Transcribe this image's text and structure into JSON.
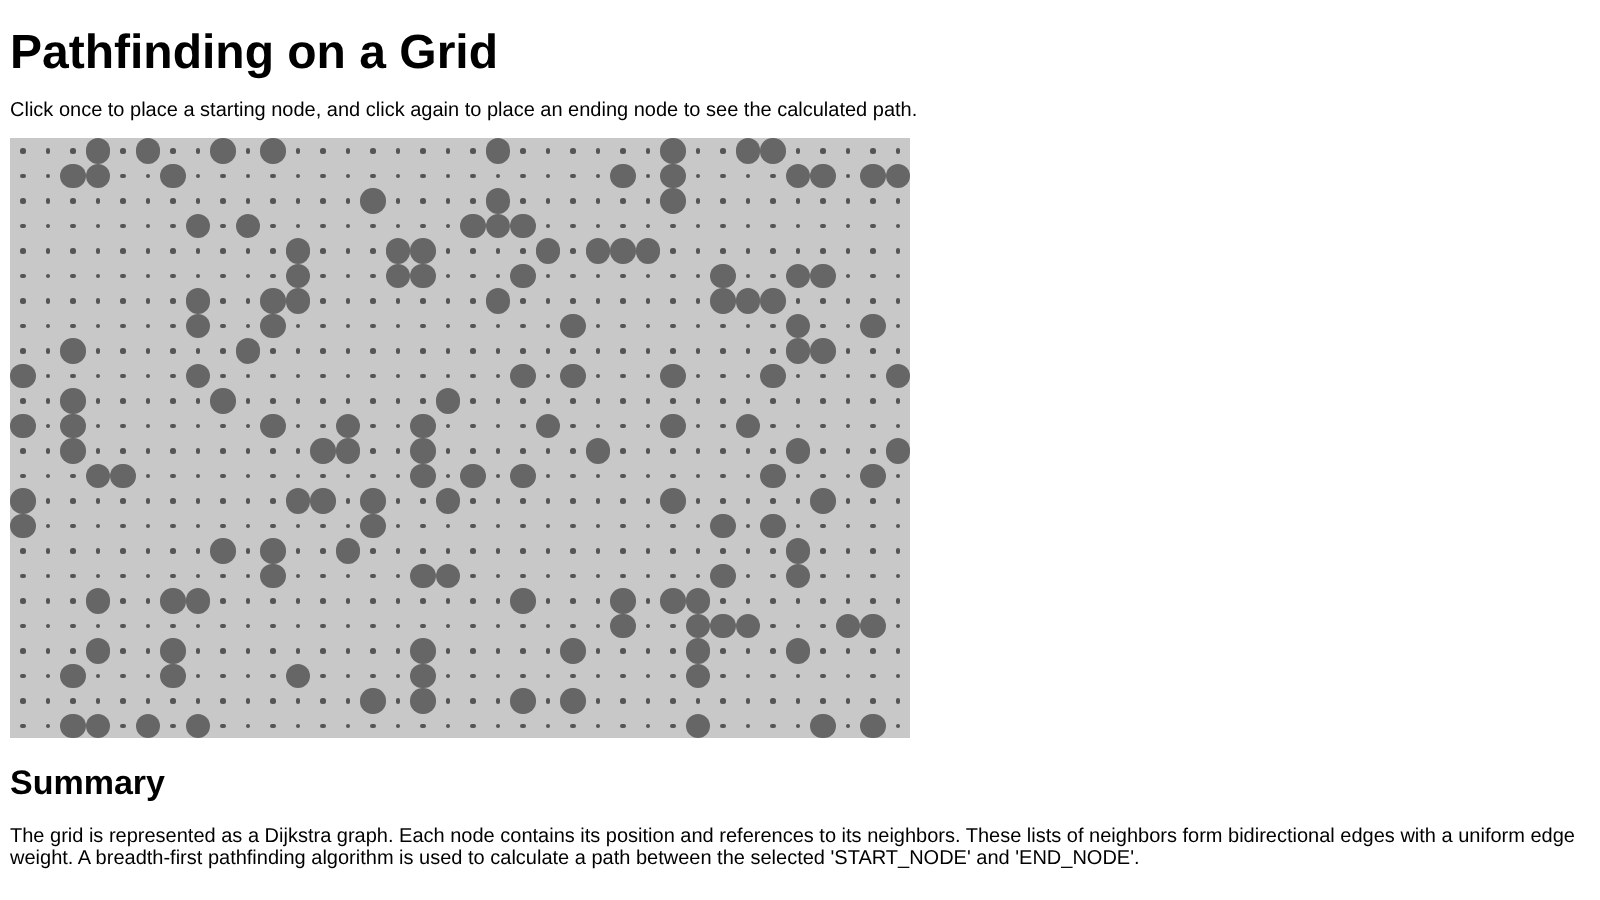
{
  "title": "Pathfinding on a Grid",
  "instructions": "Click once to place a starting node, and click again to place an ending node to see the calculated path.",
  "grid": {
    "rows": [
      [
        false,
        false,
        false,
        true,
        false,
        true,
        false,
        false,
        true,
        false,
        true,
        false,
        false,
        false,
        false,
        false,
        false,
        false,
        false,
        true,
        false,
        false,
        false,
        false,
        false,
        false,
        true,
        false,
        false,
        true,
        true,
        false,
        false,
        false,
        false,
        false
      ],
      [
        false,
        false,
        true,
        true,
        false,
        false,
        true,
        false,
        false,
        false,
        false,
        false,
        false,
        false,
        false,
        false,
        false,
        false,
        false,
        false,
        false,
        false,
        false,
        false,
        true,
        false,
        true,
        false,
        false,
        false,
        false,
        true,
        true,
        false,
        true,
        true
      ],
      [
        false,
        false,
        false,
        false,
        false,
        false,
        false,
        false,
        false,
        false,
        false,
        false,
        false,
        false,
        true,
        false,
        false,
        false,
        false,
        true,
        false,
        false,
        false,
        false,
        false,
        false,
        true,
        false,
        false,
        false,
        false,
        false,
        false,
        false,
        false,
        false
      ],
      [
        false,
        false,
        false,
        false,
        false,
        false,
        false,
        true,
        false,
        true,
        false,
        false,
        false,
        false,
        false,
        false,
        false,
        false,
        true,
        true,
        true,
        false,
        false,
        false,
        false,
        false,
        false,
        false,
        false,
        false,
        false,
        false,
        false,
        false,
        false,
        false
      ],
      [
        false,
        false,
        false,
        false,
        false,
        false,
        false,
        false,
        false,
        false,
        false,
        true,
        false,
        false,
        false,
        true,
        true,
        false,
        false,
        false,
        false,
        true,
        false,
        true,
        true,
        true,
        false,
        false,
        false,
        false,
        false,
        false,
        false,
        false,
        false,
        false
      ],
      [
        false,
        false,
        false,
        false,
        false,
        false,
        false,
        false,
        false,
        false,
        false,
        true,
        false,
        false,
        false,
        true,
        true,
        false,
        false,
        false,
        true,
        false,
        false,
        false,
        false,
        false,
        false,
        false,
        true,
        false,
        false,
        true,
        true,
        false,
        false,
        false
      ],
      [
        false,
        false,
        false,
        false,
        false,
        false,
        false,
        true,
        false,
        false,
        true,
        true,
        false,
        false,
        false,
        false,
        false,
        false,
        false,
        true,
        false,
        false,
        false,
        false,
        false,
        false,
        false,
        false,
        true,
        true,
        true,
        false,
        false,
        false,
        false,
        false
      ],
      [
        false,
        false,
        false,
        false,
        false,
        false,
        false,
        true,
        false,
        false,
        true,
        false,
        false,
        false,
        false,
        false,
        false,
        false,
        false,
        false,
        false,
        false,
        true,
        false,
        false,
        false,
        false,
        false,
        false,
        false,
        false,
        true,
        false,
        false,
        true,
        false
      ],
      [
        false,
        false,
        true,
        false,
        false,
        false,
        false,
        false,
        false,
        true,
        false,
        false,
        false,
        false,
        false,
        false,
        false,
        false,
        false,
        false,
        false,
        false,
        false,
        false,
        false,
        false,
        false,
        false,
        false,
        false,
        false,
        true,
        true,
        false,
        false,
        false
      ],
      [
        true,
        false,
        false,
        false,
        false,
        false,
        false,
        true,
        false,
        false,
        false,
        false,
        false,
        false,
        false,
        false,
        false,
        false,
        false,
        false,
        true,
        false,
        true,
        false,
        false,
        false,
        true,
        false,
        false,
        false,
        true,
        false,
        false,
        false,
        false,
        true
      ],
      [
        false,
        false,
        true,
        false,
        false,
        false,
        false,
        false,
        true,
        false,
        false,
        false,
        false,
        false,
        false,
        false,
        false,
        true,
        false,
        false,
        false,
        false,
        false,
        false,
        false,
        false,
        false,
        false,
        false,
        false,
        false,
        false,
        false,
        false,
        false,
        false
      ],
      [
        true,
        false,
        true,
        false,
        false,
        false,
        false,
        false,
        false,
        false,
        true,
        false,
        false,
        true,
        false,
        false,
        true,
        false,
        false,
        false,
        false,
        true,
        false,
        false,
        false,
        false,
        true,
        false,
        false,
        true,
        false,
        false,
        false,
        false,
        false,
        false
      ],
      [
        false,
        false,
        true,
        false,
        false,
        false,
        false,
        false,
        false,
        false,
        false,
        false,
        true,
        true,
        false,
        false,
        true,
        false,
        false,
        false,
        false,
        false,
        false,
        true,
        false,
        false,
        false,
        false,
        false,
        false,
        false,
        true,
        false,
        false,
        false,
        true
      ],
      [
        false,
        false,
        false,
        true,
        true,
        false,
        false,
        false,
        false,
        false,
        false,
        false,
        false,
        false,
        false,
        false,
        true,
        false,
        true,
        false,
        true,
        false,
        false,
        false,
        false,
        false,
        false,
        false,
        false,
        false,
        true,
        false,
        false,
        false,
        true,
        false
      ],
      [
        true,
        false,
        false,
        false,
        false,
        false,
        false,
        false,
        false,
        false,
        false,
        true,
        true,
        false,
        true,
        false,
        false,
        true,
        false,
        false,
        false,
        false,
        false,
        false,
        false,
        false,
        true,
        false,
        false,
        false,
        false,
        false,
        true,
        false,
        false,
        false
      ],
      [
        true,
        false,
        false,
        false,
        false,
        false,
        false,
        false,
        false,
        false,
        false,
        false,
        false,
        false,
        true,
        false,
        false,
        false,
        false,
        false,
        false,
        false,
        false,
        false,
        false,
        false,
        false,
        false,
        true,
        false,
        true,
        false,
        false,
        false,
        false,
        false
      ],
      [
        false,
        false,
        false,
        false,
        false,
        false,
        false,
        false,
        true,
        false,
        true,
        false,
        false,
        true,
        false,
        false,
        false,
        false,
        false,
        false,
        false,
        false,
        false,
        false,
        false,
        false,
        false,
        false,
        false,
        false,
        false,
        true,
        false,
        false,
        false,
        false
      ],
      [
        false,
        false,
        false,
        false,
        false,
        false,
        false,
        false,
        false,
        false,
        true,
        false,
        false,
        false,
        false,
        false,
        true,
        true,
        false,
        false,
        false,
        false,
        false,
        false,
        false,
        false,
        false,
        false,
        true,
        false,
        false,
        true,
        false,
        false,
        false,
        false
      ],
      [
        false,
        false,
        false,
        true,
        false,
        false,
        true,
        true,
        false,
        false,
        false,
        false,
        false,
        false,
        false,
        false,
        false,
        false,
        false,
        false,
        true,
        false,
        false,
        false,
        true,
        false,
        true,
        true,
        false,
        false,
        false,
        false,
        false,
        false,
        false,
        false
      ],
      [
        false,
        false,
        false,
        false,
        false,
        false,
        false,
        false,
        false,
        false,
        false,
        false,
        false,
        false,
        false,
        false,
        false,
        false,
        false,
        false,
        false,
        false,
        false,
        false,
        true,
        false,
        false,
        true,
        true,
        true,
        false,
        false,
        false,
        true,
        true,
        false
      ],
      [
        false,
        false,
        false,
        true,
        false,
        false,
        true,
        false,
        false,
        false,
        false,
        false,
        false,
        false,
        false,
        false,
        true,
        false,
        false,
        false,
        false,
        false,
        true,
        false,
        false,
        false,
        false,
        true,
        false,
        false,
        false,
        true,
        false,
        false,
        false,
        false
      ],
      [
        false,
        false,
        true,
        false,
        false,
        false,
        true,
        false,
        false,
        false,
        false,
        true,
        false,
        false,
        false,
        false,
        true,
        false,
        false,
        false,
        false,
        false,
        false,
        false,
        false,
        false,
        false,
        true,
        false,
        false,
        false,
        false,
        false,
        false,
        false,
        false
      ],
      [
        false,
        false,
        false,
        false,
        false,
        false,
        false,
        false,
        false,
        false,
        false,
        false,
        false,
        false,
        true,
        false,
        true,
        false,
        false,
        false,
        true,
        false,
        true,
        false,
        false,
        false,
        false,
        false,
        false,
        false,
        false,
        false,
        false,
        false,
        false,
        false
      ],
      [
        false,
        false,
        true,
        true,
        false,
        true,
        false,
        true,
        false,
        false,
        false,
        false,
        false,
        false,
        false,
        false,
        false,
        false,
        false,
        false,
        false,
        false,
        false,
        false,
        false,
        false,
        false,
        true,
        false,
        false,
        false,
        false,
        true,
        false,
        true,
        false
      ]
    ]
  },
  "summary": {
    "heading": "Summary",
    "text": "The grid is represented as a Dijkstra graph. Each node contains its position and references to its neighbors. These lists of neighbors form bidirectional edges with a uniform edge weight. A breadth-first pathfinding algorithm is used to calculate a path between the selected 'START_NODE' and 'END_NODE'."
  }
}
